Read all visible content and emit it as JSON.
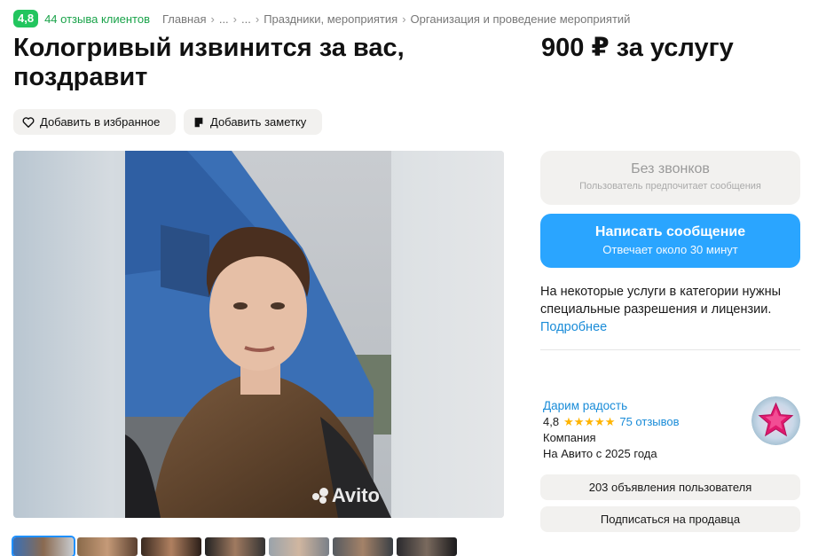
{
  "top": {
    "rating": "4,8",
    "reviews_link": "44 отзыва клиентов",
    "breadcrumbs": [
      "Главная",
      "...",
      "...",
      "Праздники, мероприятия",
      "Организация и проведение мероприятий"
    ]
  },
  "listing": {
    "title": "Кологривый извинится за вас, поздравит",
    "price": "900 ₽ за услугу",
    "add_favorite": "Добавить в избранное",
    "add_note": "Добавить заметку"
  },
  "gallery": {
    "watermark": "Avito",
    "thumbnail_count": 7
  },
  "contact": {
    "no_calls_title": "Без звонков",
    "no_calls_sub": "Пользователь предпочитает сообщения",
    "write_title": "Написать сообщение",
    "write_sub": "Отвечает около 30 минут"
  },
  "notice": {
    "text": "На некоторые услуги в категории нужны специальные разрешения и лицензии.",
    "more": "Подробнее"
  },
  "seller": {
    "name": "Дарим радость",
    "rating": "4,8",
    "stars": "★★★★★",
    "reviews": "75 отзывов",
    "type": "Компания",
    "since": "На Авито с 2025 года",
    "listings_button": "203 объявления пользователя",
    "subscribe_button": "Подписаться на продавца"
  },
  "colors": {
    "accent_blue": "#2aa5ff",
    "rating_green": "#22c55e",
    "link_blue": "#1a8cd8",
    "star_yellow": "#ffb400"
  }
}
